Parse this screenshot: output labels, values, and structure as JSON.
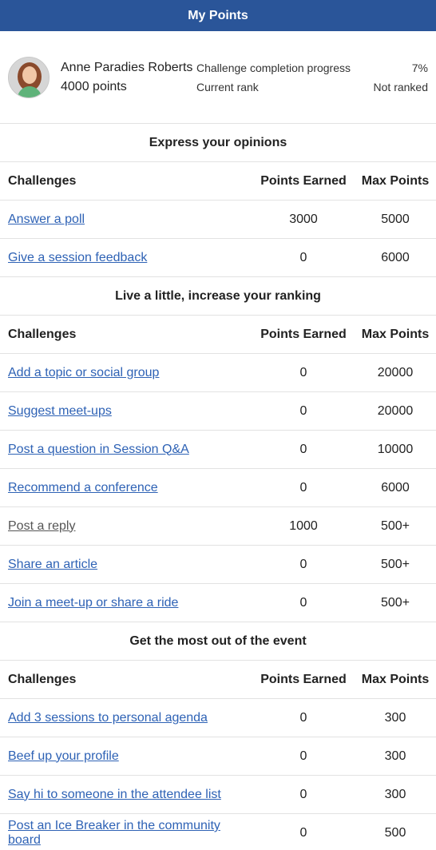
{
  "header": {
    "title": "My Points"
  },
  "profile": {
    "name": "Anne Paradies Roberts",
    "points": "4000 points",
    "stats": [
      {
        "label": "Challenge completion progress",
        "value": "7%"
      },
      {
        "label": "Current rank",
        "value": "Not ranked"
      }
    ]
  },
  "columns": {
    "challenges": "Challenges",
    "earned": "Points Earned",
    "max": "Max Points"
  },
  "sections": [
    {
      "title": "Express your opinions",
      "rows": [
        {
          "name": "Answer a poll",
          "earned": "3000",
          "max": "5000"
        },
        {
          "name": "Give a session feedback",
          "earned": "0",
          "max": "6000"
        }
      ]
    },
    {
      "title": "Live a little, increase your ranking",
      "rows": [
        {
          "name": "Add a topic or social group",
          "earned": "0",
          "max": "20000"
        },
        {
          "name": "Suggest meet-ups",
          "earned": "0",
          "max": "20000"
        },
        {
          "name": "Post a question in Session Q&A",
          "earned": "0",
          "max": "10000"
        },
        {
          "name": "Recommend a conference",
          "earned": "0",
          "max": "6000"
        },
        {
          "name": "Post a reply",
          "earned": "1000",
          "max": "500+"
        },
        {
          "name": "Share an article",
          "earned": "0",
          "max": "500+"
        },
        {
          "name": "Join a meet-up or share a ride",
          "earned": "0",
          "max": "500+"
        }
      ]
    },
    {
      "title": "Get the most out of the event",
      "rows": [
        {
          "name": "Add 3 sessions to personal agenda",
          "earned": "0",
          "max": "300"
        },
        {
          "name": "Beef up your profile",
          "earned": "0",
          "max": "300"
        },
        {
          "name": "Say hi to someone in the attendee list",
          "earned": "0",
          "max": "300"
        },
        {
          "name": "Post an Ice Breaker in the community board",
          "earned": "0",
          "max": "500"
        }
      ]
    }
  ]
}
